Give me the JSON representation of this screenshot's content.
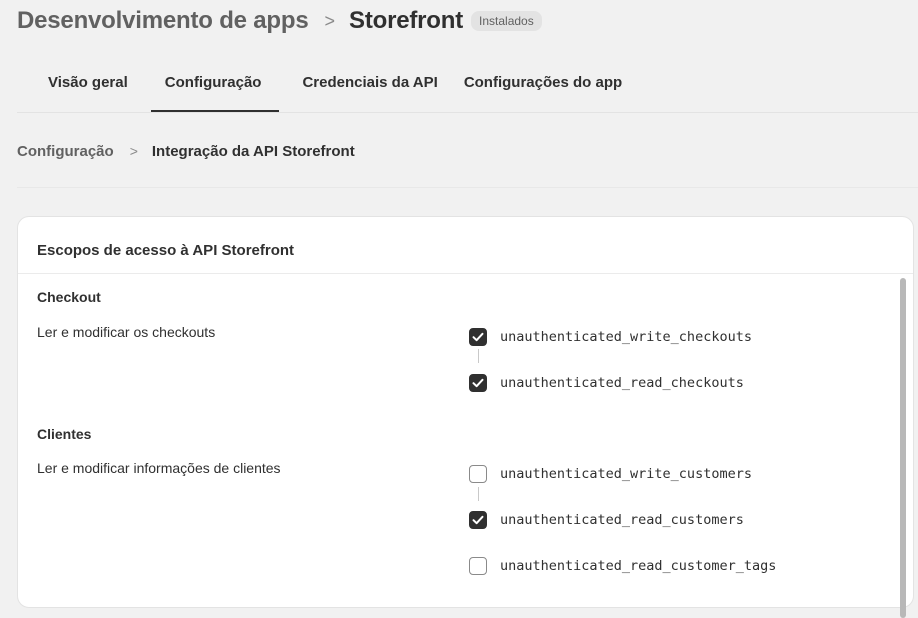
{
  "header": {
    "parent": "Desenvolvimento de apps",
    "separator": ">",
    "title": "Storefront",
    "badge": "Instalados"
  },
  "tabs": [
    {
      "label": "Visão geral",
      "active": false
    },
    {
      "label": "Configuração",
      "active": true
    },
    {
      "label": "Credenciais da API",
      "active": false
    },
    {
      "label": "Configurações do app",
      "active": false
    }
  ],
  "breadcrumb": {
    "parent": "Configuração",
    "separator": ">",
    "current": "Integração da API Storefront"
  },
  "card": {
    "title": "Escopos de acesso à API Storefront",
    "sections": [
      {
        "title": "Checkout",
        "description": "Ler e modificar os checkouts",
        "scopes": [
          {
            "name": "unauthenticated_write_checkouts",
            "checked": true
          },
          {
            "name": "unauthenticated_read_checkouts",
            "checked": true
          }
        ]
      },
      {
        "title": "Clientes",
        "description": "Ler e modificar informações de clientes",
        "scopes": [
          {
            "name": "unauthenticated_write_customers",
            "checked": false
          },
          {
            "name": "unauthenticated_read_customers",
            "checked": true
          },
          {
            "name": "unauthenticated_read_customer_tags",
            "checked": false
          }
        ]
      }
    ]
  },
  "colors": {
    "background": "#f1f1f1",
    "card": "#ffffff",
    "checked": "#303030",
    "text": "#303030",
    "muted": "#616161"
  }
}
